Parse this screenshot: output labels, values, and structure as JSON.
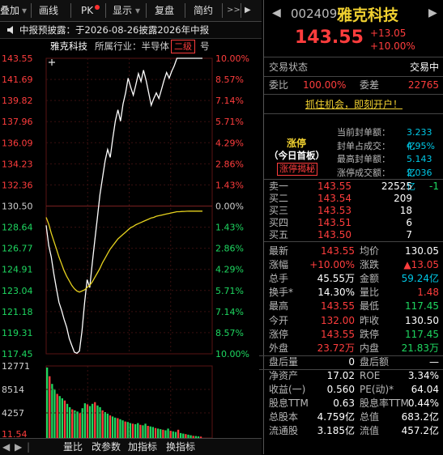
{
  "toolbar": {
    "items": [
      "叠加",
      "画线",
      "PK",
      "显示",
      "复盘",
      "简约"
    ],
    "left_arrow": "◀",
    "right_arrow": "▶",
    "more": ">>",
    "dropdown": "▾"
  },
  "notice": {
    "text": "中报预披露：于2026-08-26披露2026年中报"
  },
  "chart_header": {
    "stock_name": "雅克科技",
    "industry_label": "所属行业：半导体",
    "level_tag": "二级",
    "extra": "号"
  },
  "stock": {
    "code": "002409",
    "name": "雅克科技",
    "price": "143.55",
    "change": "+13.05",
    "change_pct": "+10.00%"
  },
  "status": {
    "label": "交易状态",
    "value": "交易中",
    "weibi_label": "委比",
    "weibi_value": "100.00%",
    "weicha_label": "委差",
    "weicha_value": "22765",
    "promo": "抓住机会，即刻开户！"
  },
  "limit": {
    "title": "涨停",
    "subtitle": "（今日首板）",
    "link": "涨停揭秘",
    "rows": [
      {
        "label": "当前封单额：",
        "value": "3.233亿"
      },
      {
        "label": "封单占成交：",
        "value": "4.95%"
      },
      {
        "label": "最高封单额：",
        "value": "5.143亿"
      },
      {
        "label": "涨停成交额：",
        "value": "2.036亿"
      }
    ]
  },
  "order_book": [
    {
      "label": "卖一",
      "price": "143.55",
      "vol": "22525",
      "chg": "-1"
    },
    {
      "label": "买二",
      "price": "143.54",
      "vol": "209",
      "chg": ""
    },
    {
      "label": "买三",
      "price": "143.53",
      "vol": "18",
      "chg": ""
    },
    {
      "label": "买四",
      "price": "143.51",
      "vol": "6",
      "chg": ""
    },
    {
      "label": "买五",
      "price": "143.50",
      "vol": "7",
      "chg": ""
    }
  ],
  "stats_left": [
    {
      "label": "最新",
      "value": "143.55",
      "color": "up"
    },
    {
      "label": "涨幅",
      "value": "+10.00%",
      "color": "up"
    },
    {
      "label": "总手",
      "value": "45.55万",
      "color": "white"
    },
    {
      "label": "换手*",
      "value": "14.30%",
      "color": "white"
    },
    {
      "label": "最高",
      "value": "143.55",
      "color": "up"
    },
    {
      "label": "今开",
      "value": "132.00",
      "color": "up"
    },
    {
      "label": "涨停",
      "value": "143.55",
      "color": "up"
    },
    {
      "label": "外盘",
      "value": "23.72万",
      "color": "up"
    },
    {
      "label": "盘后量",
      "value": "0",
      "color": "white"
    },
    {
      "label": "净资产",
      "value": "17.02",
      "color": "white"
    },
    {
      "label": "收益(一)",
      "value": "0.560",
      "color": "white"
    },
    {
      "label": "股息TTM",
      "value": "0.63",
      "color": "white"
    },
    {
      "label": "总股本",
      "value": "4.759亿",
      "color": "white"
    },
    {
      "label": "流通股",
      "value": "3.185亿",
      "color": "white"
    }
  ],
  "stats_right": [
    {
      "label": "均价",
      "value": "130.05",
      "color": "white"
    },
    {
      "label": "涨跌",
      "value": "▲13.05",
      "color": "up"
    },
    {
      "label": "金额",
      "value": "59.24亿",
      "color": "cyan"
    },
    {
      "label": "量比",
      "value": "1.48",
      "color": "up"
    },
    {
      "label": "最低",
      "value": "117.45",
      "color": "down"
    },
    {
      "label": "昨收",
      "value": "130.50",
      "color": "white"
    },
    {
      "label": "跌停",
      "value": "117.45",
      "color": "down"
    },
    {
      "label": "内盘",
      "value": "21.83万",
      "color": "down"
    },
    {
      "label": "盘后额",
      "value": "—",
      "color": "white"
    },
    {
      "label": "ROE",
      "value": "3.34%",
      "color": "white"
    },
    {
      "label": "PE(动)*",
      "value": "64.04",
      "color": "white"
    },
    {
      "label": "股息率TTM",
      "value": "0.44%",
      "color": "white"
    },
    {
      "label": "总值",
      "value": "683.2亿",
      "color": "white"
    },
    {
      "label": "流值",
      "value": "457.2亿",
      "color": "white"
    }
  ],
  "bottom_bar": {
    "items": [
      "量比",
      "改参数",
      "加指标",
      "换指标"
    ]
  },
  "chart_data": {
    "type": "line",
    "price_axis_left": [
      "143.55",
      "141.69",
      "139.82",
      "137.96",
      "136.09",
      "134.23",
      "132.36",
      "130.50",
      "128.64",
      "126.77",
      "124.91",
      "123.04",
      "121.18",
      "119.31",
      "117.45"
    ],
    "pct_axis_right": [
      "10.00%",
      "8.57%",
      "7.14%",
      "5.71%",
      "4.29%",
      "2.86%",
      "1.43%",
      "0.00%",
      "1.43%",
      "2.86%",
      "4.29%",
      "5.71%",
      "7.14%",
      "8.57%",
      "10.00%"
    ],
    "ylim": [
      117.45,
      143.55
    ],
    "prev_close": 130.5,
    "series": [
      {
        "name": "price",
        "color": "#ffffff",
        "values": [
          128.8,
          127.0,
          126.0,
          124.5,
          123.2,
          122.0,
          121.3,
          120.5,
          119.8,
          118.8,
          118.2,
          117.6,
          117.5,
          117.7,
          119.5,
          122.0,
          124.0,
          123.3,
          125.5,
          127.5,
          129.5,
          131.5,
          133.0,
          134.5,
          135.5,
          134.8,
          136.5,
          138.0,
          139.0,
          138.0,
          139.5,
          140.5,
          141.8,
          141.0,
          140.3,
          141.2,
          142.2,
          141.5,
          142.5,
          141.6,
          140.5,
          139.4,
          140.0,
          140.5,
          140.0,
          140.8,
          141.6,
          142.3,
          141.8,
          142.4,
          142.9,
          143.55,
          143.55,
          143.55,
          143.55,
          143.55,
          143.55,
          143.55,
          143.55,
          143.55,
          143.55,
          143.55
        ]
      },
      {
        "name": "avg",
        "color": "#e6d21e",
        "values": [
          129.5,
          128.9,
          128.1,
          127.4,
          126.7,
          126.0,
          125.4,
          124.8,
          124.3,
          123.9,
          123.5,
          123.2,
          123.0,
          122.9,
          123.0,
          123.1,
          123.3,
          123.5,
          123.8,
          124.2,
          124.6,
          125.0,
          125.5,
          125.9,
          126.3,
          126.7,
          127.0,
          127.3,
          127.6,
          127.8,
          128.0,
          128.2,
          128.4,
          128.6,
          128.7,
          128.85,
          128.95,
          129.05,
          129.15,
          129.25,
          129.35,
          129.45,
          129.5,
          129.6,
          129.65,
          129.7,
          129.75,
          129.8,
          129.85,
          129.9,
          129.95,
          130.0,
          130.0,
          130.02,
          130.03,
          130.04,
          130.05,
          130.05,
          130.05,
          130.05,
          130.05,
          130.05
        ]
      }
    ],
    "volume_axis": [
      "12771",
      "8514",
      "4257",
      "11.54"
    ],
    "volume": [
      12771,
      11200,
      9800,
      8900,
      8000,
      7600,
      7200,
      6800,
      6200,
      5600,
      5200,
      5000,
      4800,
      4600,
      5400,
      6300,
      6100,
      5800,
      6200,
      6500,
      5900,
      5600,
      5000,
      4700,
      4400,
      4100,
      3900,
      3700,
      3600,
      3400,
      3200,
      3000,
      2900,
      2700,
      2600,
      2500,
      2700,
      2400,
      2300,
      2600,
      2200,
      2100,
      2000,
      1800,
      1700,
      1600,
      1500,
      1400,
      1700,
      1300,
      1200,
      1100,
      1500,
      900,
      800,
      700,
      600,
      500,
      400,
      350,
      300,
      250
    ]
  }
}
